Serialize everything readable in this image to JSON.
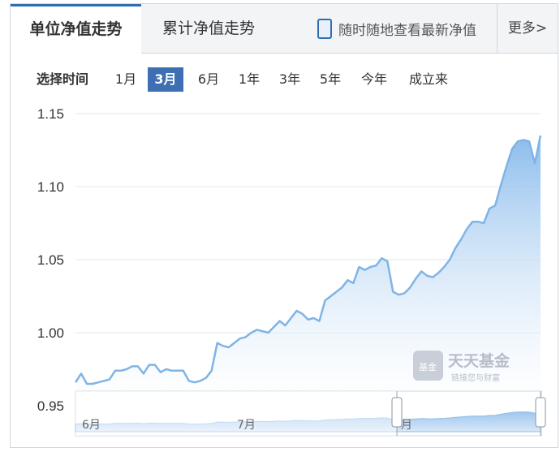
{
  "tabs": {
    "unit_nav": "单位净值走势",
    "cumulative_nav": "累计净值走势",
    "mobile_link": "随时随地查看最新净值",
    "more": "更多>"
  },
  "periods": {
    "label": "选择时间",
    "options": [
      "1月",
      "3月",
      "6月",
      "1年",
      "3年",
      "5年",
      "今年",
      "成立来"
    ],
    "selected": "3月"
  },
  "watermark": {
    "logo_text": "基金",
    "title": "天天基金",
    "subtitle": "链接您与财富"
  },
  "colors": {
    "line": "#7fb4e6",
    "area_top": "#8bbcec",
    "area_bottom": "#ffffff",
    "grid": "#e2e6ec",
    "accent": "#3d6fb2"
  },
  "chart_data": {
    "type": "area",
    "title": "",
    "xlabel": "",
    "ylabel": "",
    "ylim": [
      0.95,
      1.15
    ],
    "yticks": [
      "1.15",
      "1.10",
      "1.05",
      "1.00",
      "0.95"
    ],
    "grid": true,
    "navigator_labels": [
      "6月",
      "7月",
      "月"
    ],
    "series": [
      {
        "values": [
          0.966,
          0.972,
          0.965,
          0.965,
          0.966,
          0.967,
          0.968,
          0.974,
          0.974,
          0.975,
          0.977,
          0.977,
          0.972,
          0.978,
          0.978,
          0.973,
          0.975,
          0.974,
          0.974,
          0.974,
          0.967,
          0.966,
          0.967,
          0.969,
          0.974,
          0.993,
          0.991,
          0.99,
          0.993,
          0.996,
          0.997,
          1.0,
          1.002,
          1.001,
          1.0,
          1.004,
          1.008,
          1.005,
          1.01,
          1.015,
          1.013,
          1.009,
          1.01,
          1.008,
          1.022,
          1.025,
          1.028,
          1.031,
          1.036,
          1.034,
          1.045,
          1.043,
          1.045,
          1.046,
          1.051,
          1.049,
          1.028,
          1.026,
          1.027,
          1.031,
          1.037,
          1.042,
          1.039,
          1.038,
          1.041,
          1.045,
          1.05,
          1.058,
          1.064,
          1.071,
          1.076,
          1.076,
          1.075,
          1.085,
          1.087,
          1.101,
          1.114,
          1.126,
          1.131,
          1.132,
          1.131,
          1.116,
          1.135
        ]
      }
    ]
  }
}
